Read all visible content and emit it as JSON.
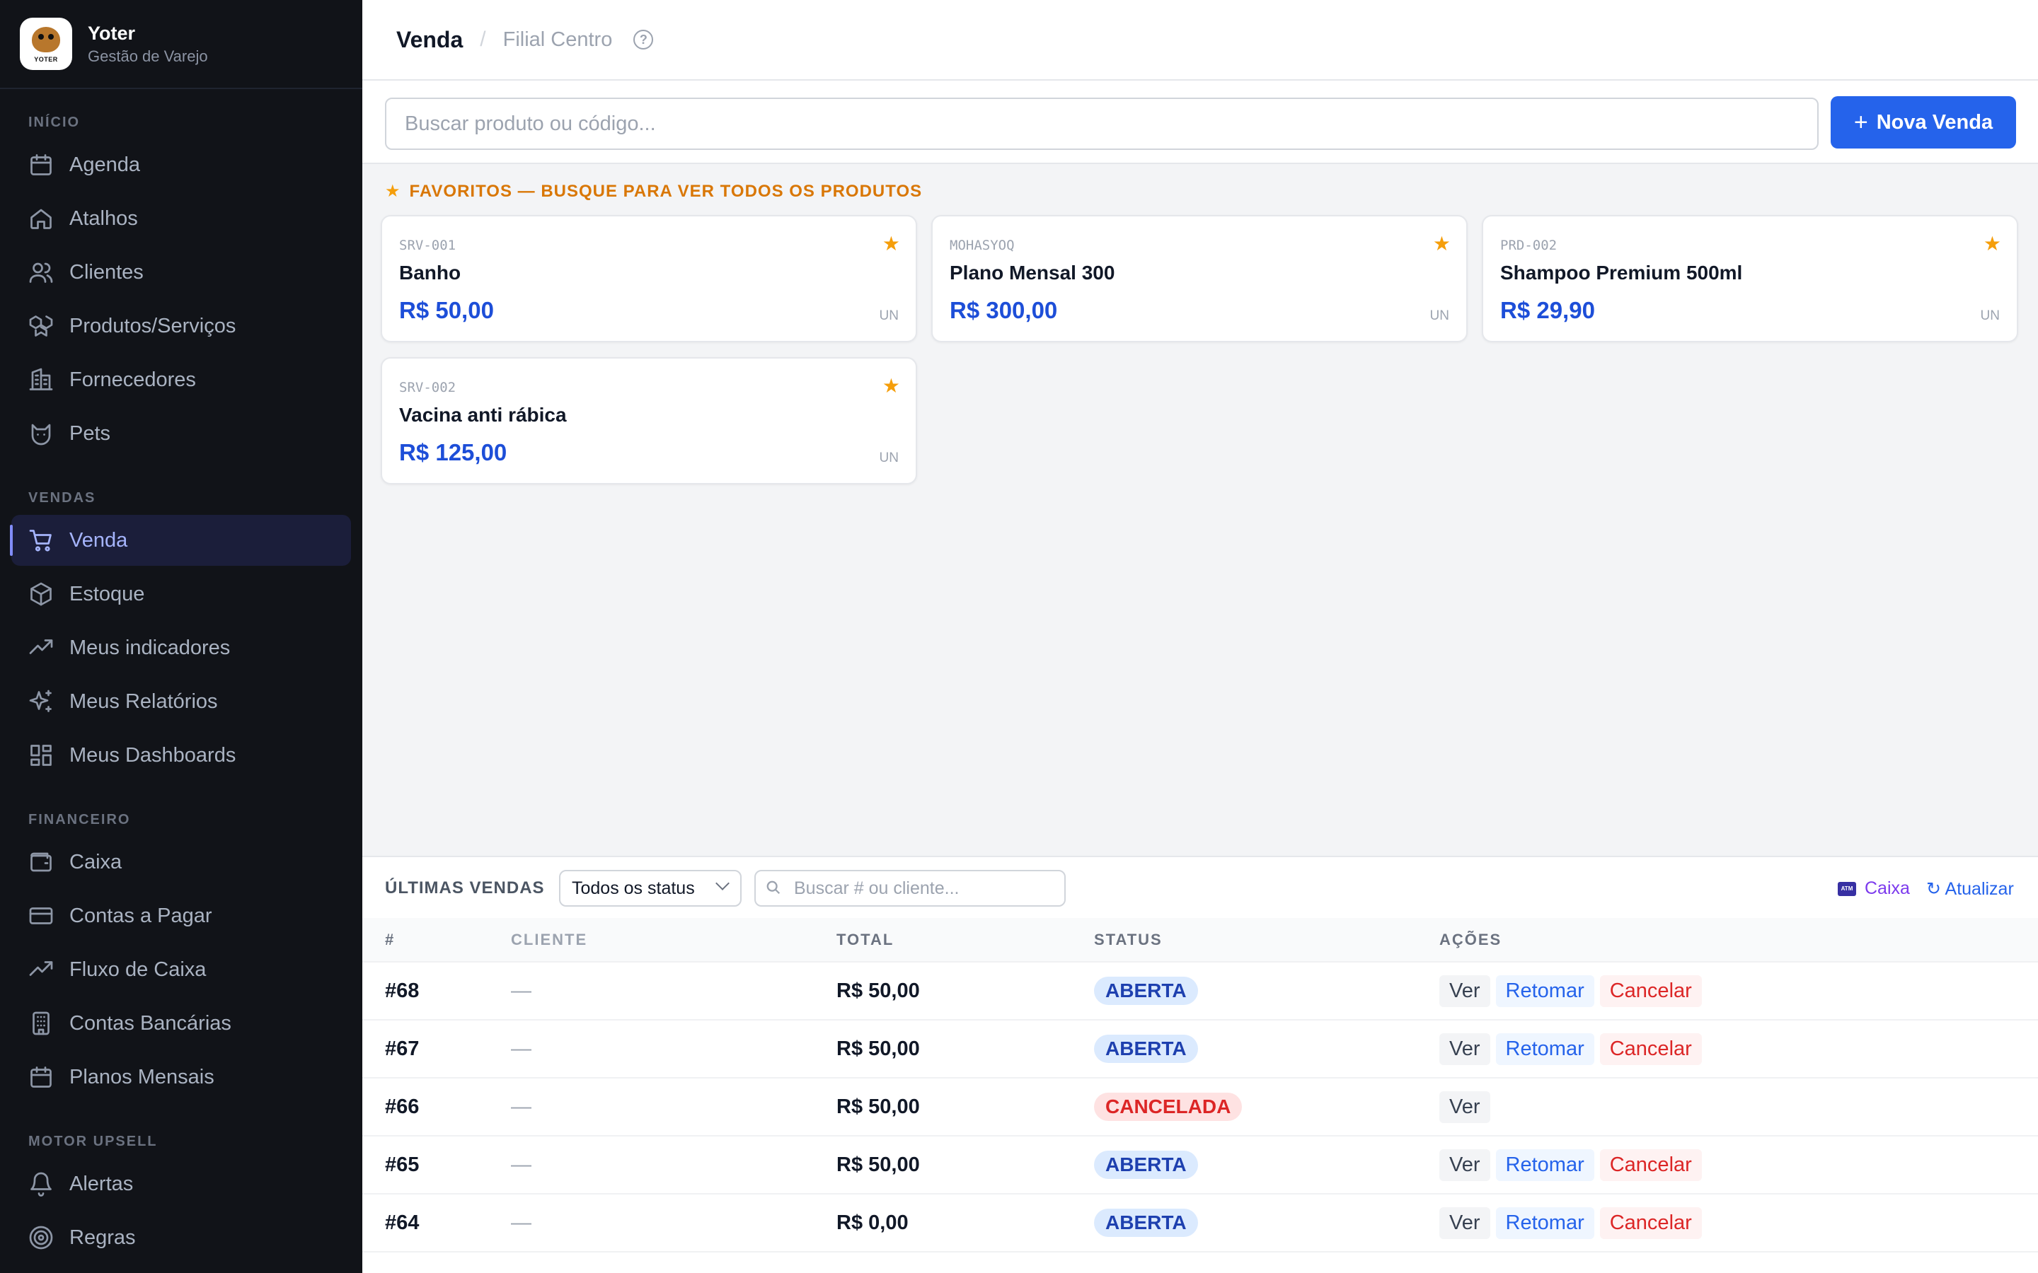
{
  "brand": {
    "name": "Yoter",
    "subtitle": "Gestão de Varejo",
    "logo_text": "YOTER"
  },
  "sidebar": {
    "sections": [
      {
        "title": "INÍCIO",
        "items": [
          {
            "label": "Agenda",
            "icon": "calendar-icon"
          },
          {
            "label": "Atalhos",
            "icon": "home-icon"
          },
          {
            "label": "Clientes",
            "icon": "users-icon"
          },
          {
            "label": "Produtos/Serviços",
            "icon": "boxes-icon"
          },
          {
            "label": "Fornecedores",
            "icon": "building-icon"
          },
          {
            "label": "Pets",
            "icon": "cat-icon"
          }
        ]
      },
      {
        "title": "VENDAS",
        "items": [
          {
            "label": "Venda",
            "icon": "cart-icon",
            "active": true
          },
          {
            "label": "Estoque",
            "icon": "package-icon"
          },
          {
            "label": "Meus indicadores",
            "icon": "trend-icon"
          },
          {
            "label": "Meus Relatórios",
            "icon": "sparkles-icon"
          },
          {
            "label": "Meus Dashboards",
            "icon": "dashboard-icon"
          }
        ]
      },
      {
        "title": "FINANCEIRO",
        "items": [
          {
            "label": "Caixa",
            "icon": "wallet-icon"
          },
          {
            "label": "Contas a Pagar",
            "icon": "credit-card-icon"
          },
          {
            "label": "Fluxo de Caixa",
            "icon": "trend-icon"
          },
          {
            "label": "Contas Bancárias",
            "icon": "bank-icon"
          },
          {
            "label": "Planos Mensais",
            "icon": "calendar-icon"
          }
        ]
      },
      {
        "title": "MOTOR UPSELL",
        "items": [
          {
            "label": "Alertas",
            "icon": "bell-icon"
          },
          {
            "label": "Regras",
            "icon": "target-icon"
          }
        ]
      }
    ]
  },
  "header": {
    "title": "Venda",
    "separator": "/",
    "branch": "Filial Centro"
  },
  "search": {
    "placeholder": "Buscar produto ou código...",
    "value": ""
  },
  "new_sale_button": {
    "plus": "+",
    "label": "Nova Venda"
  },
  "favorites": {
    "heading": "FAVORITOS — BUSQUE PARA VER TODOS OS PRODUTOS",
    "items": [
      {
        "code": "SRV-001",
        "name": "Banho",
        "price": "R$ 50,00",
        "unit": "UN"
      },
      {
        "code": "MOHASYOQ",
        "name": "Plano Mensal 300",
        "price": "R$ 300,00",
        "unit": "UN"
      },
      {
        "code": "PRD-002",
        "name": "Shampoo Premium 500ml",
        "price": "R$ 29,90",
        "unit": "UN"
      },
      {
        "code": "SRV-002",
        "name": "Vacina anti rábica",
        "price": "R$ 125,00",
        "unit": "UN"
      }
    ]
  },
  "recent_sales": {
    "title": "ÚLTIMAS VENDAS",
    "status_filter": "Todos os status",
    "search_placeholder": "Buscar # ou cliente...",
    "caixa_link": "Caixa",
    "refresh_link": "↻ Atualizar",
    "columns": [
      "#",
      "CLIENTE",
      "TOTAL",
      "STATUS",
      "AÇÕES"
    ],
    "rows": [
      {
        "id": "#68",
        "client": "—",
        "total": "R$ 50,00",
        "status": "ABERTA",
        "actions": [
          "Ver",
          "Retomar",
          "Cancelar"
        ]
      },
      {
        "id": "#67",
        "client": "—",
        "total": "R$ 50,00",
        "status": "ABERTA",
        "actions": [
          "Ver",
          "Retomar",
          "Cancelar"
        ]
      },
      {
        "id": "#66",
        "client": "—",
        "total": "R$ 50,00",
        "status": "CANCELADA",
        "actions": [
          "Ver"
        ]
      },
      {
        "id": "#65",
        "client": "—",
        "total": "R$ 50,00",
        "status": "ABERTA",
        "actions": [
          "Ver",
          "Retomar",
          "Cancelar"
        ]
      },
      {
        "id": "#64",
        "client": "—",
        "total": "R$ 0,00",
        "status": "ABERTA",
        "actions": [
          "Ver",
          "Retomar",
          "Cancelar"
        ]
      }
    ]
  },
  "colors": {
    "accent": "#2563eb",
    "sidebar_bg": "#111318",
    "active_nav": "#a5b4fc",
    "favorite": "#d97706"
  }
}
